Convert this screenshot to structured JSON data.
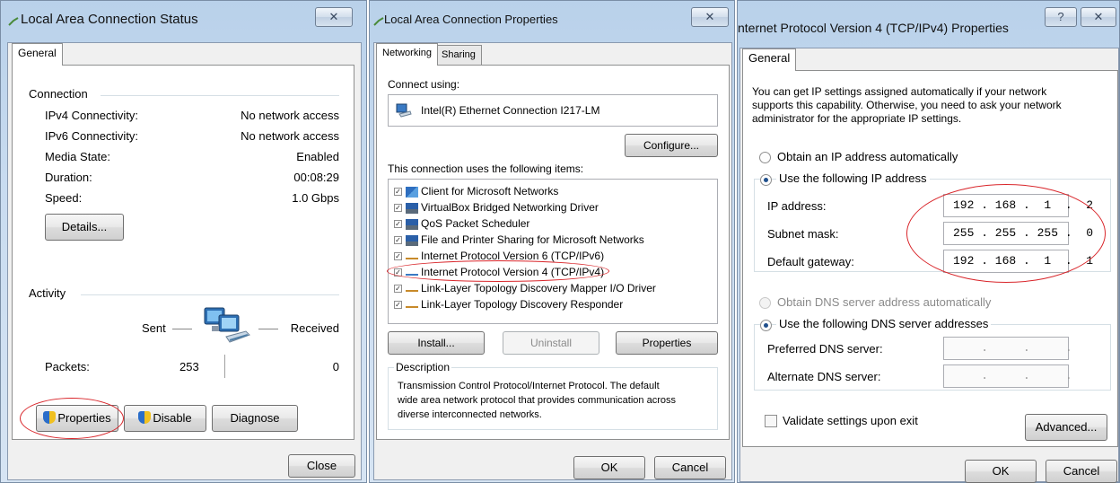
{
  "status_dialog": {
    "title": "Local Area Connection Status",
    "close_glyph": "✕",
    "tab_general": "General",
    "connection": {
      "group_label": "Connection",
      "rows": [
        {
          "label": "IPv4 Connectivity:",
          "value": "No network access"
        },
        {
          "label": "IPv6 Connectivity:",
          "value": "No network access"
        },
        {
          "label": "Media State:",
          "value": "Enabled"
        },
        {
          "label": "Duration:",
          "value": "00:08:29"
        },
        {
          "label": "Speed:",
          "value": "1.0 Gbps"
        }
      ],
      "details_button": "Details..."
    },
    "activity": {
      "group_label": "Activity",
      "sent_label": "Sent",
      "received_label": "Received",
      "packets_label": "Packets:",
      "packets_sent": "253",
      "packets_received": "0"
    },
    "properties_button": "Properties",
    "disable_button": "Disable",
    "diagnose_button": "Diagnose",
    "close_button": "Close"
  },
  "properties_dialog": {
    "title": "Local Area Connection Properties",
    "close_glyph": "✕",
    "tab_networking": "Networking",
    "tab_sharing": "Sharing",
    "connect_using_label": "Connect using:",
    "adapter_name": "Intel(R) Ethernet Connection I217-LM",
    "configure_button": "Configure...",
    "items_label": "This connection uses the following items:",
    "items": [
      {
        "label": "Client for Microsoft Networks",
        "checked": true,
        "icon": "network-client-icon"
      },
      {
        "label": "VirtualBox Bridged Networking Driver",
        "checked": true,
        "icon": "network-service-icon"
      },
      {
        "label": "QoS Packet Scheduler",
        "checked": true,
        "icon": "network-service-icon"
      },
      {
        "label": "File and Printer Sharing for Microsoft Networks",
        "checked": true,
        "icon": "network-service-icon"
      },
      {
        "label": "Internet Protocol Version 6 (TCP/IPv6)",
        "checked": true,
        "icon": "protocol-icon"
      },
      {
        "label": "Internet Protocol Version 4 (TCP/IPv4)",
        "checked": true,
        "icon": "protocol-icon"
      },
      {
        "label": "Link-Layer Topology Discovery Mapper I/O Driver",
        "checked": true,
        "icon": "protocol-icon"
      },
      {
        "label": "Link-Layer Topology Discovery Responder",
        "checked": true,
        "icon": "protocol-icon"
      }
    ],
    "install_button": "Install...",
    "uninstall_button": "Uninstall",
    "properties_button": "Properties",
    "description_label": "Description",
    "description_text_lines": [
      "Transmission Control Protocol/Internet Protocol. The default",
      "wide area network protocol that provides communication across",
      "diverse interconnected networks."
    ],
    "ok_button": "OK",
    "cancel_button": "Cancel"
  },
  "ipv4_dialog": {
    "title": "nternet Protocol Version 4 (TCP/IPv4) Properties",
    "help_glyph": "?",
    "close_glyph": "✕",
    "tab_general": "General",
    "intro_lines": [
      "You can get IP settings assigned automatically if your network",
      "supports this capability. Otherwise, you need to ask your network",
      "administrator for the appropriate IP settings."
    ],
    "obtain_ip_auto": "Obtain an IP address automatically",
    "use_following_ip": "Use the following IP address",
    "ip_address_label": "IP address:",
    "ip_address_value": "192 . 168 .  1  .  2",
    "subnet_mask_label": "Subnet mask:",
    "subnet_mask_value": "255 . 255 . 255 .  0",
    "gateway_label": "Default gateway:",
    "gateway_value": "192 . 168 .  1  .  1",
    "obtain_dns_auto": "Obtain DNS server address automatically",
    "use_following_dns": "Use the following DNS server addresses",
    "preferred_dns_label": "Preferred DNS server:",
    "preferred_dns_value": "    .     .     .",
    "alternate_dns_label": "Alternate DNS server:",
    "alternate_dns_value": "    .     .     .",
    "validate_label": "Validate settings upon exit",
    "advanced_button": "Advanced...",
    "ok_button": "OK",
    "cancel_button": "Cancel"
  }
}
